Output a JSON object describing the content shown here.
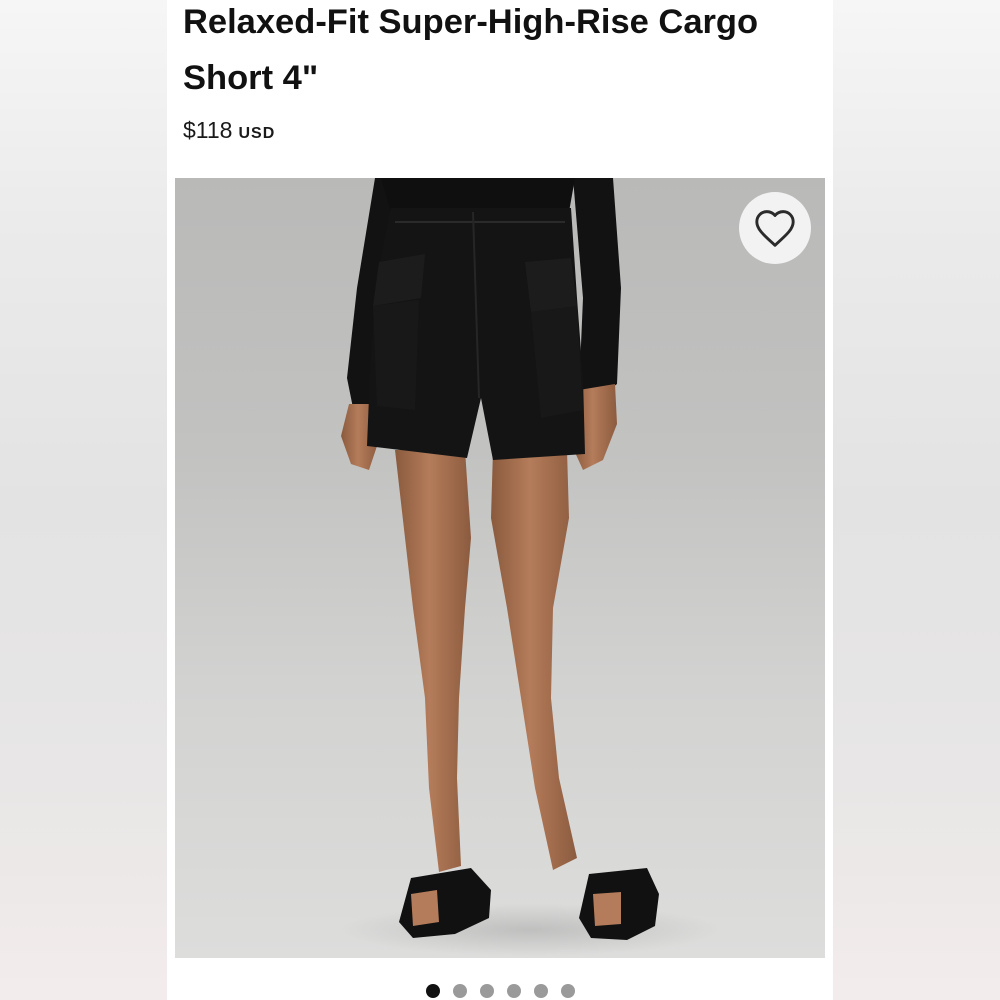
{
  "product": {
    "title": "Relaxed-Fit Super-High-Rise Cargo Short 4\"",
    "price": "$118",
    "currency": "USD"
  },
  "image": {
    "alt": "Model wearing black cargo shorts and black slide sandals",
    "favorite_icon": "heart-outline-icon"
  },
  "carousel": {
    "total": 6,
    "active_index": 0
  },
  "colors": {
    "title": "#111111",
    "image_background": "#c6c6c5",
    "garment": "#141414",
    "active_dot": "#111111",
    "inactive_dot": "#9a9a9a"
  }
}
